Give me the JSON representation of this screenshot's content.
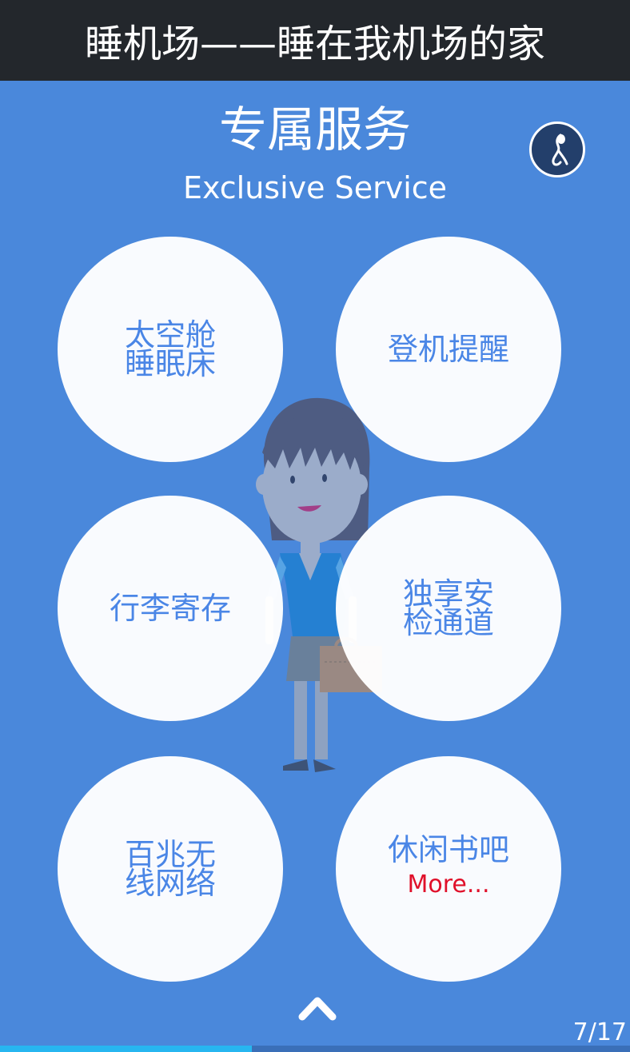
{
  "header": {
    "title": "睡机场——睡在我机场的家"
  },
  "page": {
    "heading_cn": "专属服务",
    "heading_en": "Exclusive Service"
  },
  "colors": {
    "background": "#4a88db",
    "header_bg": "#23272c",
    "circle_text": "#4a86e6",
    "more_text": "#e0102a",
    "progress": "#27b6f0"
  },
  "icons": {
    "music": "music-note-icon",
    "up": "chevron-up-icon"
  },
  "services": [
    {
      "label": "太空舱\n睡眠床"
    },
    {
      "label": "登机提醒"
    },
    {
      "label": "行李寄存"
    },
    {
      "label": "独享安\n检通道"
    },
    {
      "label": "百兆无\n线网络"
    },
    {
      "label": "休闲书吧",
      "more": "More..."
    }
  ],
  "pagination": {
    "current": 7,
    "total": 17,
    "label": "7/17",
    "progress_fraction": 0.4
  }
}
